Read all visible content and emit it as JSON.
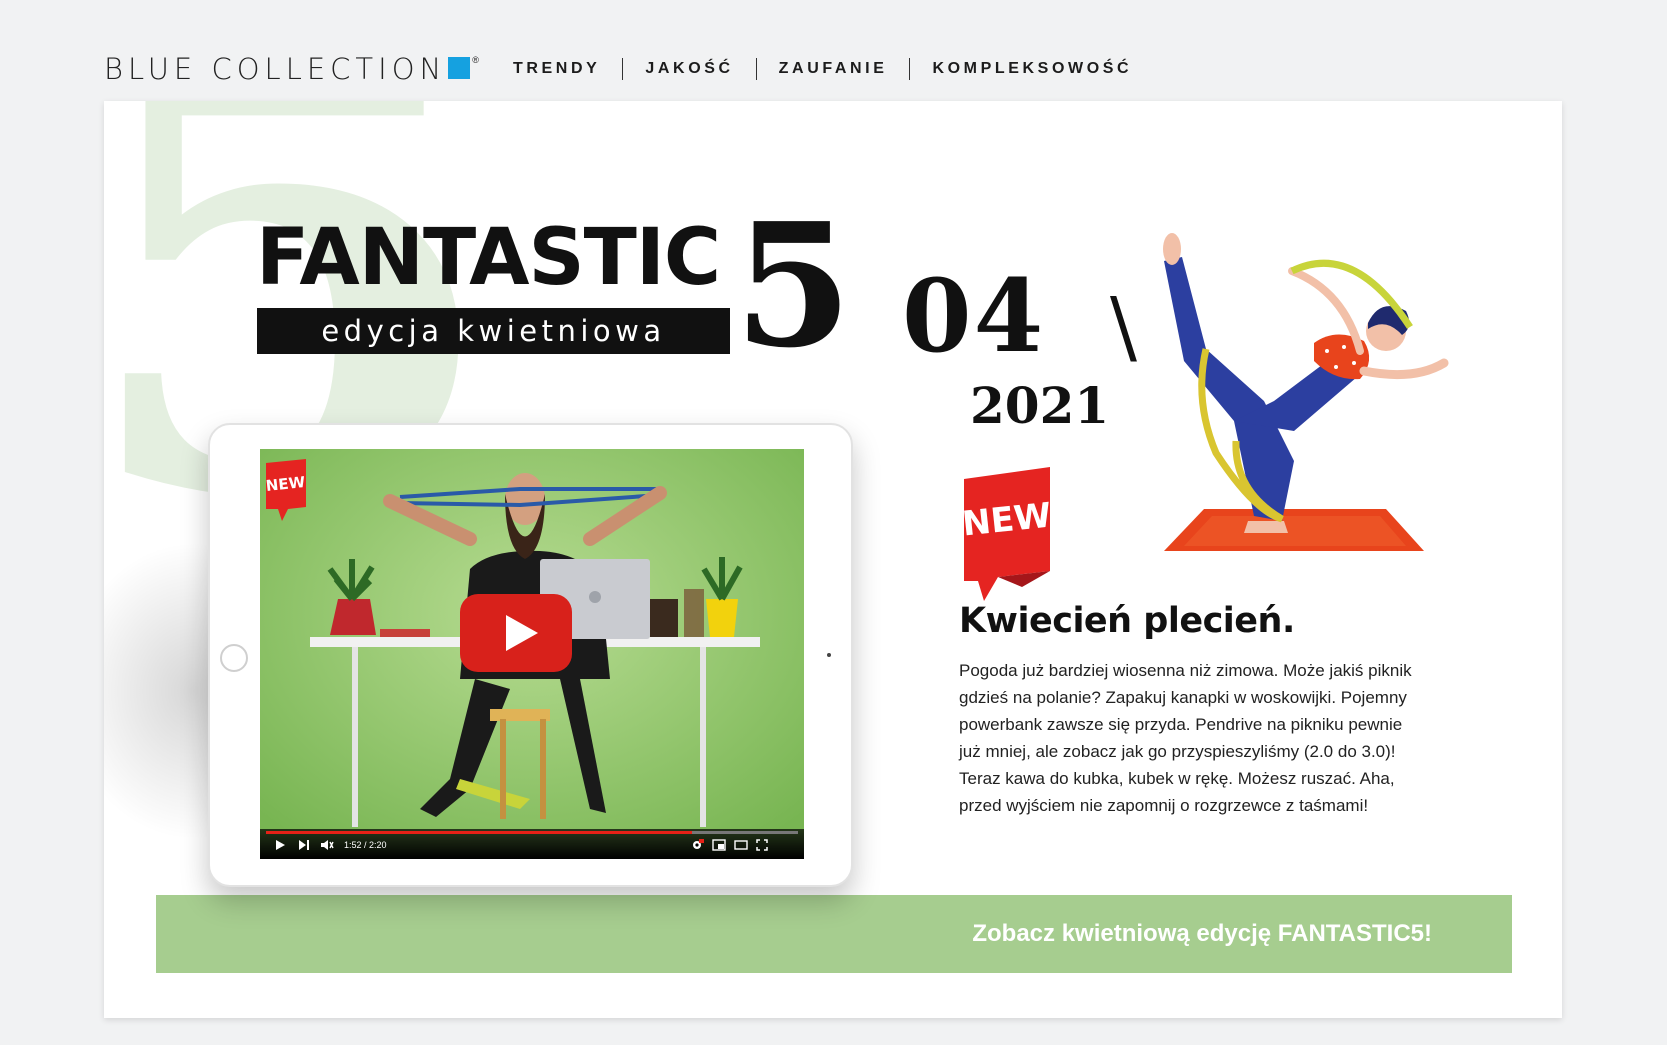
{
  "brand": {
    "name": "BLUE COLLECTION",
    "reg": "®",
    "accent": "#15a1e0"
  },
  "nav": {
    "items": [
      "TRENDY",
      "JAKOŚĆ",
      "ZAUFANIE",
      "KOMPLEKSOWOŚĆ"
    ]
  },
  "hero": {
    "headline": "FANTASTIC",
    "subtitle": "edycja kwietniowa",
    "number": "5",
    "month": "04",
    "slash": "\\",
    "year": "2021",
    "badge": "NEW"
  },
  "video": {
    "badge": "NEW",
    "time": "1:52 / 2:20",
    "progress": 0.8
  },
  "article": {
    "title": "Kwiecień plecień.",
    "lines": [
      "Pogoda już bardziej wiosenna niż zimowa. Może jakiś piknik",
      "gdzieś na polanie? Zapakuj kanapki w woskowijki. Pojemny",
      "powerbank zawsze się przyda. Pendrive na pikniku pewnie",
      "już mniej, ale zobacz jak go przyspieszyliśmy (2.0 do 3.0)!",
      "Teraz kawa do kubka, kubek w rękę. Możesz ruszać. Aha,",
      "przed wyjściem nie zapomnij o rozgrzewce z taśmami!"
    ]
  },
  "cta": {
    "label": "Zobacz kwietniową edycję FANTASTIC5!",
    "color": "#a6cd8f"
  },
  "icons": [
    "play-icon",
    "next-icon",
    "mute-icon",
    "settings-icon",
    "miniplayer-icon",
    "theater-icon",
    "fullscreen-icon",
    "youtube-play-icon"
  ]
}
